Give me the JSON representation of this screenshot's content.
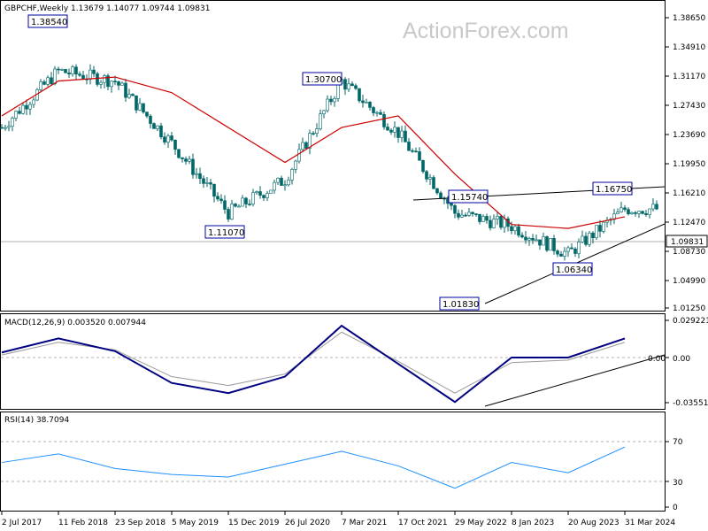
{
  "watermark": "ActionForex.com",
  "price_panel": {
    "header": "GBPCHF,Weekly  1.13679 1.14077 1.09744 1.09831",
    "current_label": "1.09831",
    "y_ticks": [
      "1.38650",
      "1.34910",
      "1.31170",
      "1.27430",
      "1.23690",
      "1.19950",
      "1.16210",
      "1.12470",
      "1.08730",
      "1.04990",
      "1.01250"
    ],
    "annotations": [
      "1.38540",
      "1.30700",
      "1.11070",
      "1.15740",
      "1.16750",
      "1.06340",
      "1.01830"
    ]
  },
  "macd_panel": {
    "header": "MACD(12,26,9) 0.003520 0.007944",
    "y_ticks": [
      "0.029221",
      "0.00",
      "-0.035518"
    ],
    "current_value_label": "0.00"
  },
  "rsi_panel": {
    "header": "RSI(14) 38.7094",
    "y_ticks": [
      "70",
      "30",
      "0"
    ]
  },
  "x_axis": {
    "labels": [
      "2 Jul 2017",
      "11 Feb 2018",
      "23 Sep 2018",
      "5 May 2019",
      "15 Dec 2019",
      "26 Jul 2020",
      "7 Mar 2021",
      "17 Oct 2021",
      "29 May 2022",
      "8 Jan 2023",
      "20 Aug 2023",
      "31 Mar 2024"
    ]
  },
  "colors": {
    "candles": "#006666",
    "sma": "#cc0000",
    "macd_line": "#000080",
    "signal_line": "#999999",
    "rsi_line": "#1e90ff",
    "trendline": "#000000",
    "label_border": "#0000a0"
  },
  "chart_data": [
    {
      "type": "candlestick",
      "title": "GBPCHF,Weekly",
      "ohlc_last": {
        "open": 1.13679,
        "high": 1.14077,
        "low": 1.09744,
        "close": 1.09831
      },
      "ylim": [
        1.0125,
        1.3865
      ],
      "x": [
        "2 Jul 2017",
        "11 Feb 2018",
        "23 Sep 2018",
        "5 May 2019",
        "15 Dec 2019",
        "26 Jul 2020",
        "7 Mar 2021",
        "17 Oct 2021",
        "29 May 2022",
        "8 Jan 2023",
        "20 Aug 2023",
        "31 Mar 2024"
      ],
      "series": [
        {
          "values": [
            1.245,
            1.318,
            1.305,
            1.225,
            1.135,
            1.178,
            1.305,
            1.238,
            1.135,
            1.118,
            1.082,
            1.14
          ]
        },
        {
          "values": [
            1.26,
            1.305,
            1.31,
            1.29,
            1.245,
            1.2,
            1.245,
            1.26,
            1.185,
            1.12,
            1.115,
            1.13
          ]
        }
      ],
      "swing_labels": [
        {
          "date": "11 Feb 2018",
          "value": 1.3854
        },
        {
          "date": "7 Mar 2021",
          "value": 1.307
        },
        {
          "date": "15 Dec 2019",
          "value": 1.1107
        },
        {
          "date": "29 May 2022",
          "value": 1.1574
        },
        {
          "date": "31 Mar 2024",
          "value": 1.1675
        },
        {
          "date": "20 Aug 2023",
          "value": 1.0634
        },
        {
          "date": "29 May 2022",
          "value": 1.0183
        }
      ]
    },
    {
      "type": "line",
      "title": "MACD(12,26,9)",
      "ylim": [
        -0.035518,
        0.029221
      ],
      "x": [
        "2 Jul 2017",
        "11 Feb 2018",
        "23 Sep 2018",
        "5 May 2019",
        "15 Dec 2019",
        "26 Jul 2020",
        "7 Mar 2021",
        "17 Oct 2021",
        "29 May 2022",
        "8 Jan 2023",
        "20 Aug 2023",
        "31 Mar 2024"
      ],
      "series": [
        {
          "values": [
            0.004,
            0.015,
            0.005,
            -0.02,
            -0.028,
            -0.015,
            0.025,
            -0.005,
            -0.035,
            0.0,
            0.0,
            0.015
          ]
        },
        {
          "values": [
            0.002,
            0.012,
            0.006,
            -0.015,
            -0.022,
            -0.013,
            0.02,
            -0.003,
            -0.028,
            -0.004,
            -0.002,
            0.012
          ]
        }
      ],
      "last": {
        "macd": 0.00352,
        "signal": 0.007944
      }
    },
    {
      "type": "line",
      "title": "RSI(14)",
      "ylim": [
        0,
        100
      ],
      "x": [
        "2 Jul 2017",
        "11 Feb 2018",
        "23 Sep 2018",
        "5 May 2019",
        "15 Dec 2019",
        "26 Jul 2020",
        "7 Mar 2021",
        "17 Oct 2021",
        "29 May 2022",
        "8 Jan 2023",
        "20 Aug 2023",
        "31 Mar 2024"
      ],
      "series": [
        {
          "values": [
            52,
            62,
            45,
            38,
            35,
            50,
            65,
            48,
            22,
            52,
            40,
            70
          ]
        }
      ],
      "last": 38.7094,
      "levels": [
        70,
        30
      ]
    }
  ]
}
